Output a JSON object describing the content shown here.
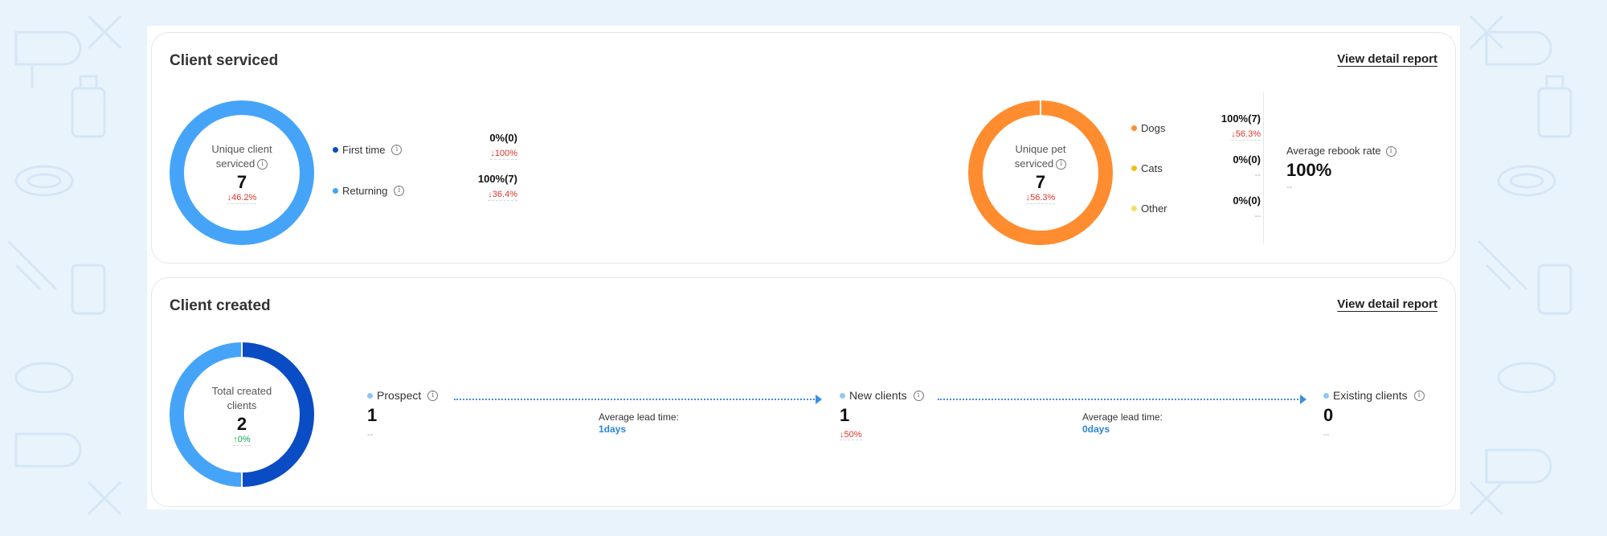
{
  "colors": {
    "dark_blue": "#0a4cc4",
    "light_blue": "#45a4f8",
    "orange": "#ff8c2e",
    "yellow": "#f2bd1e",
    "pale_yellow": "#f6dc66",
    "down": "#e0342a",
    "up": "#14a44d",
    "link_blue": "#2a86d8"
  },
  "client_serviced": {
    "title": "Client serviced",
    "detail_link": "View detail report",
    "unique_client": {
      "label": "Unique client serviced",
      "value": "7",
      "change": "↓46.2%",
      "info_icon": "info-icon"
    },
    "client_breakdown": [
      {
        "label": "First time",
        "percent": "0%(0)",
        "change": "↓100%",
        "dot_color": "#0a4cc4",
        "share": 0
      },
      {
        "label": "Returning",
        "percent": "100%(7)",
        "change": "↓36.4%",
        "dot_color": "#45a4f8",
        "share": 1
      }
    ],
    "unique_pet": {
      "label": "Unique pet serviced",
      "value": "7",
      "change": "↓56.3%"
    },
    "pet_breakdown": [
      {
        "label": "Dogs",
        "percent": "100%(7)",
        "change": "↓56.3%",
        "dot_color": "#ff8c2e",
        "share": 1
      },
      {
        "label": "Cats",
        "percent": "0%(0)",
        "change": "--",
        "dot_color": "#f2bd1e",
        "share": 0
      },
      {
        "label": "Other",
        "percent": "0%(0)",
        "change": "--",
        "dot_color": "#f6dc66",
        "share": 0
      }
    ],
    "rebook": {
      "label": "Average rebook rate",
      "value": "100%",
      "change": "--"
    }
  },
  "client_created": {
    "title": "Client created",
    "detail_link": "View detail report",
    "total": {
      "label": "Total created clients",
      "value": "2",
      "change": "↑0%",
      "segments": [
        0.5,
        0.5
      ]
    },
    "stages": [
      {
        "label": "Prospect",
        "value": "1",
        "change": "--",
        "dot_color": "#8ec8f6"
      },
      {
        "label": "New clients",
        "value": "1",
        "change": "↓50%",
        "dot_color": "#8ec8f6"
      },
      {
        "label": "Existing clients",
        "value": "0",
        "change": "--",
        "dot_color": "#8ec8f6"
      }
    ],
    "lead_times": [
      {
        "label": "Average lead time:",
        "value": "1days"
      },
      {
        "label": "Average lead time:",
        "value": "0days"
      }
    ]
  }
}
